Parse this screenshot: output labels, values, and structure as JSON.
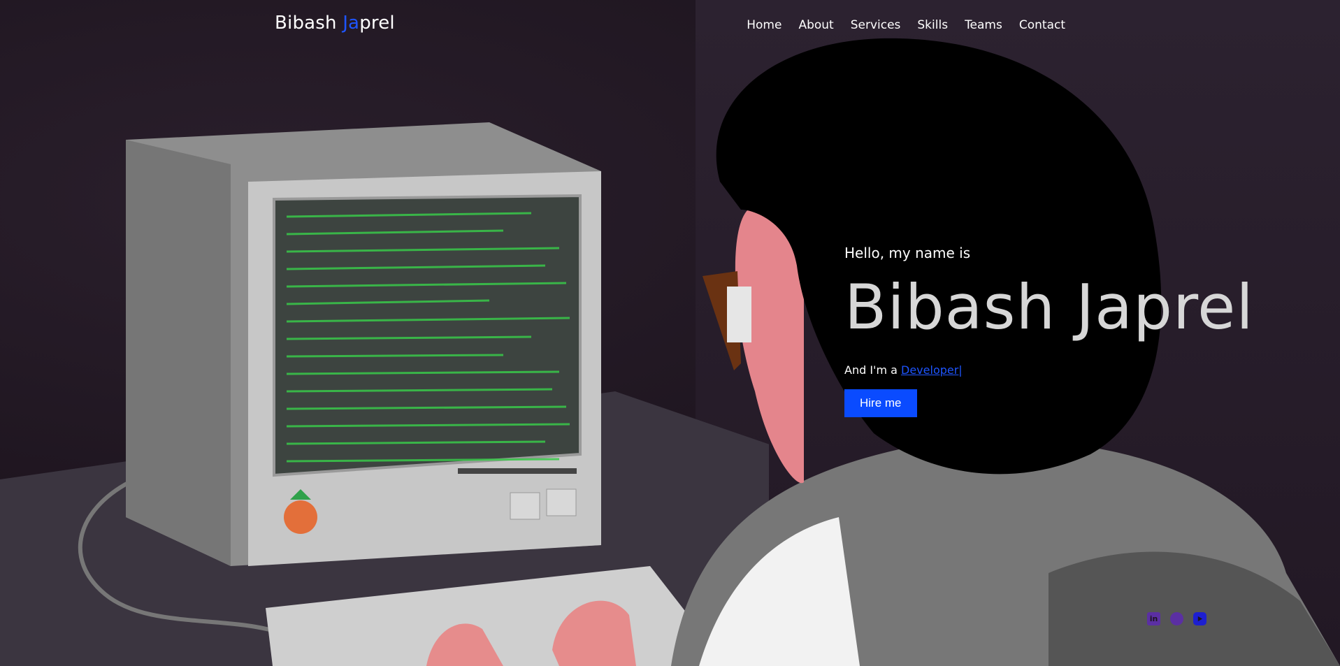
{
  "nav": {
    "logo_part1": "Bibash ",
    "logo_accent": "Ja",
    "logo_part2": "prel",
    "items": [
      "Home",
      "About",
      "Services",
      "Skills",
      "Teams",
      "Contact"
    ]
  },
  "home": {
    "greeting": "Hello, my name is",
    "name": "Bibash Japrel",
    "role_prefix": "And I'm a ",
    "role_value": "Developer|",
    "hire_button": "Hire me"
  },
  "socials": {
    "icons": [
      "linkedin-icon",
      "github-icon",
      "youtube-icon"
    ]
  },
  "colors": {
    "accent": "#1e55ff",
    "button": "#0a4bff",
    "text": "#ffffff",
    "name": "#d7d7d7"
  }
}
